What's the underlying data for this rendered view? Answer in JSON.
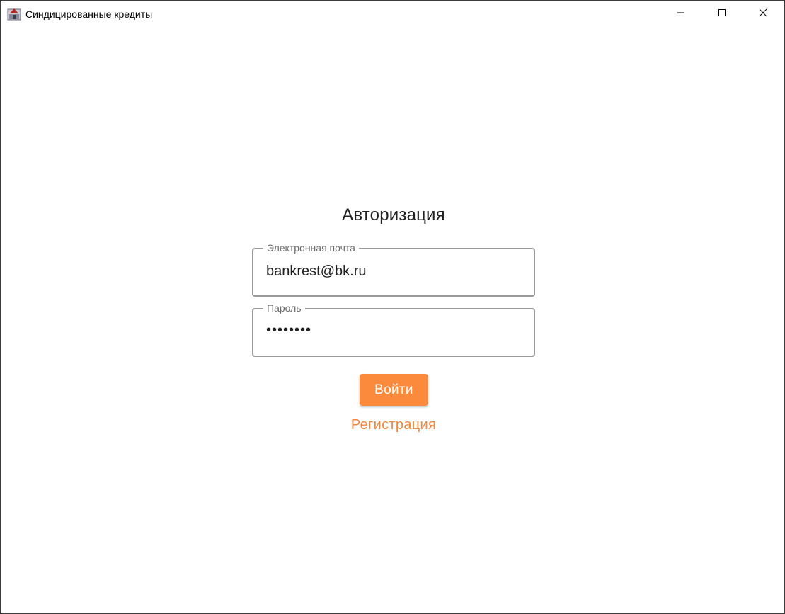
{
  "window": {
    "title": "Синдицированные кредиты",
    "icon": "app-icon"
  },
  "titlebar_buttons": {
    "minimize": "minimize-icon",
    "maximize": "maximize-icon",
    "close": "close-icon"
  },
  "login": {
    "heading": "Авторизация",
    "email": {
      "label": "Электронная почта",
      "value": "bankrest@bk.ru"
    },
    "password": {
      "label": "Пароль",
      "value": "••••••••"
    },
    "submit_label": "Войти",
    "register_label": "Регистрация"
  },
  "colors": {
    "accent": "#fb8a3c",
    "link": "#f0883f",
    "field_border": "#9a9a9a"
  }
}
